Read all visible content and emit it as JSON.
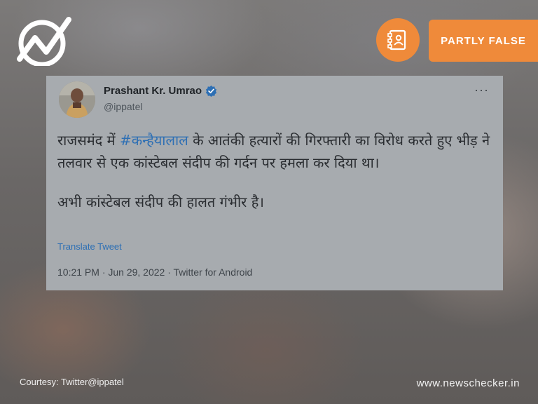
{
  "brand": {
    "site": "www.newschecker.in",
    "logo_icon": "newschecker-logo-icon"
  },
  "verdict": {
    "label": "PARTLY FALSE",
    "color": "#ef8a3a",
    "icon": "fact-check-document-icon"
  },
  "tweet": {
    "author_name": "Prashant Kr. Umrao",
    "handle": "@ippatel",
    "verified": true,
    "body_pre": "राजसमंद में ",
    "hashtag": "#कन्हैयालाल",
    "body_post": " के आतंकी हत्यारों की गिरफ्तारी का विरोध करते हुए भीड़ ने तलवार से एक कांस्टेबल संदीप की गर्दन पर हमला कर दिया था।",
    "body_second": "अभी कांस्टेबल संदीप की हालत गंभीर है।",
    "translate_label": "Translate Tweet",
    "timestamp": "10:21 PM · Jun 29, 2022 · Twitter for Android",
    "more_label": "···"
  },
  "footer": {
    "courtesy": "Courtesy: Twitter@ippatel"
  }
}
